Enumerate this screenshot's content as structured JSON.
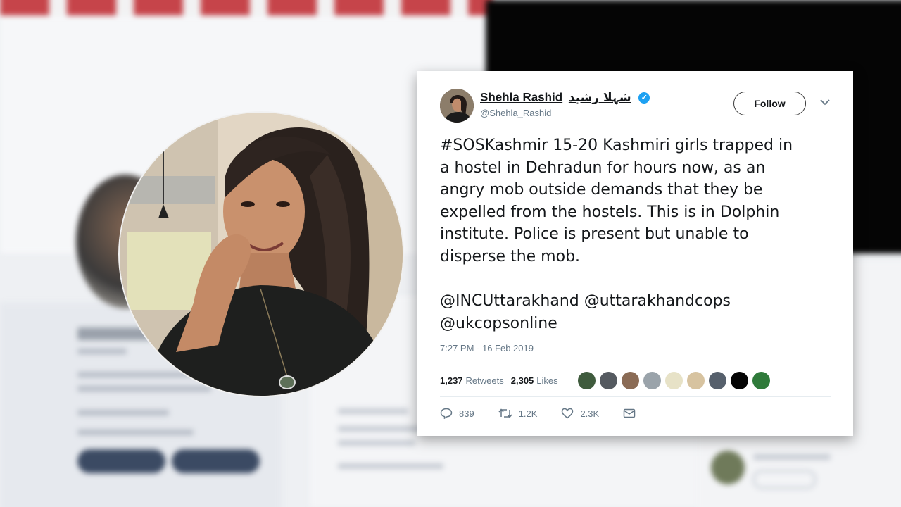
{
  "tweet": {
    "display_name": "Shehla Rashid",
    "display_name_urdu": "شہلا رشید",
    "handle": "@Shehla_Rashid",
    "follow_label": "Follow",
    "text": "#SOSKashmir 15-20 Kashmiri girls trapped in\na hostel in Dehradun for hours now, as an\nangry mob outside demands that they be\nexpelled from the hostels. This is in Dolphin\ninstitute. Police is present but unable to\ndisperse the mob.",
    "mentions_line1": "@INCUttarakhand @uttarakhandcops",
    "mentions_line2": "@ukcopsonline",
    "timestamp": "7:27 PM - 16 Feb 2019",
    "retweets_count": "1,237",
    "retweets_label": "Retweets",
    "likes_count": "2,305",
    "likes_label": "Likes",
    "replies": "839",
    "retweets_short": "1.2K",
    "likes_short": "2.3K"
  },
  "icons": {
    "verified": "verified-badge-icon",
    "caret": "chevron-down-icon",
    "reply": "reply-icon",
    "retweet": "retweet-icon",
    "like": "heart-icon",
    "dm": "envelope-icon"
  },
  "colors": {
    "verified_blue": "#1da1f2",
    "muted_text": "#657786",
    "text": "#14171a"
  }
}
